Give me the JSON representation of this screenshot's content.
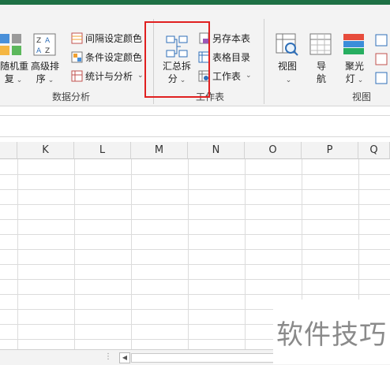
{
  "ribbon": {
    "data_analysis": {
      "group_title": "数据分析",
      "random_sort": {
        "line1": "随机重",
        "line2": "复"
      },
      "advanced_sort": {
        "line1": "高级排",
        "line2": "序"
      },
      "interval_color": "间隔设定颜色",
      "condition_color": "条件设定颜色",
      "stats_analysis": "统计与分析"
    },
    "worksheet": {
      "group_title": "工作表",
      "summary_split": {
        "line1": "汇总拆",
        "line2": "分"
      },
      "save_sheet": "另存本表",
      "table_toc": "表格目录",
      "worksheet_menu": "工作表"
    },
    "view": {
      "group_title": "视图",
      "view_btn": "视图",
      "navigation": {
        "line1": "导",
        "line2": "航"
      },
      "spotlight": {
        "line1": "聚光",
        "line2": "灯"
      }
    }
  },
  "sheet": {
    "columns": [
      "K",
      "L",
      "M",
      "N",
      "O",
      "P",
      "Q"
    ]
  },
  "watermark": "软件技巧",
  "colors": {
    "accent": "#1e7145",
    "highlight": "#e02020"
  }
}
